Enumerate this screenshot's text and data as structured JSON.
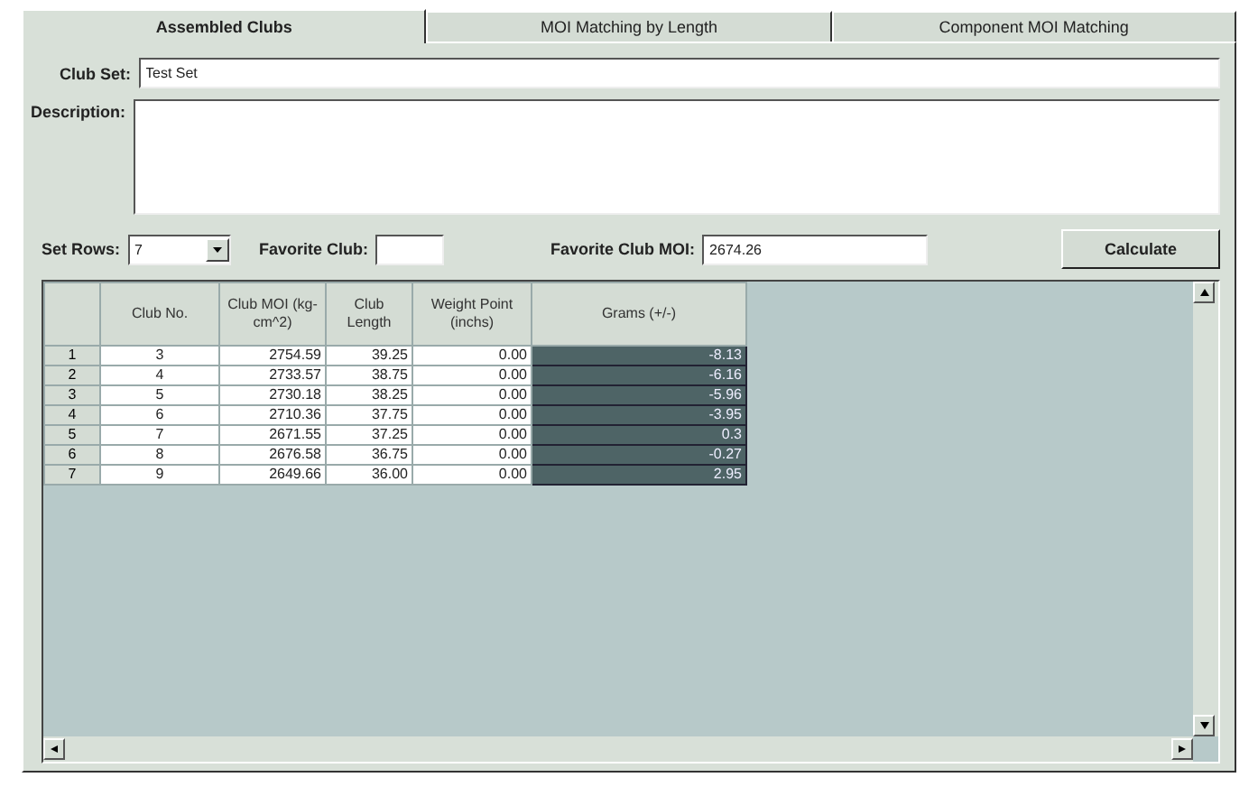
{
  "tabs": [
    {
      "label": "Assembled Clubs",
      "selected": true
    },
    {
      "label": "MOI Matching by Length",
      "selected": false
    },
    {
      "label": "Component MOI Matching",
      "selected": false
    }
  ],
  "club_set": {
    "label": "Club Set:",
    "value": "Test Set"
  },
  "description": {
    "label": "Description:"
  },
  "set_rows": {
    "label": "Set Rows:",
    "value": "7"
  },
  "favorite_club": {
    "label": "Favorite Club:"
  },
  "favorite_club_moi": {
    "label": "Favorite Club MOI:",
    "value": "2674.26"
  },
  "calculate_button": "Calculate",
  "table": {
    "columns": [
      "Club No.",
      "Club MOI (kg-cm^2)",
      "Club Length",
      "Weight Point (inchs)",
      "Grams (+/-)"
    ],
    "rows": [
      {
        "number": "1",
        "cells": [
          "3",
          "2754.59",
          "39.25",
          "0.00",
          "-8.13"
        ]
      },
      {
        "number": "2",
        "cells": [
          "4",
          "2733.57",
          "38.75",
          "0.00",
          "-6.16"
        ]
      },
      {
        "number": "3",
        "cells": [
          "5",
          "2730.18",
          "38.25",
          "0.00",
          "-5.96"
        ]
      },
      {
        "number": "4",
        "cells": [
          "6",
          "2710.36",
          "37.75",
          "0.00",
          "-3.95"
        ]
      },
      {
        "number": "5",
        "cells": [
          "7",
          "2671.55",
          "37.25",
          "0.00",
          "0.3"
        ]
      },
      {
        "number": "6",
        "cells": [
          "8",
          "2676.58",
          "36.75",
          "0.00",
          "-0.27"
        ]
      },
      {
        "number": "7",
        "cells": [
          "9",
          "2649.66",
          "36.00",
          "0.00",
          "2.95"
        ]
      }
    ]
  }
}
